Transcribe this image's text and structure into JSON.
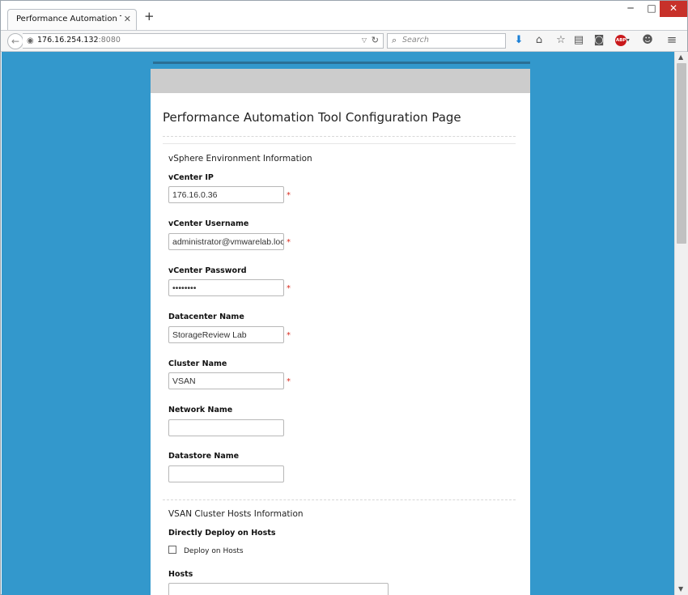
{
  "browser": {
    "tab_title": "Performance Automation Tool ...",
    "tab_close": "✕",
    "new_tab": "+",
    "window_controls": {
      "minimize": "─",
      "maximize": "□",
      "close": "✕"
    },
    "back_icon": "←",
    "url_host": "176.16.254.132",
    "url_port": ":8080",
    "url_globe_icon": "globe-icon",
    "dropdown_glyph": "▽",
    "reload_glyph": "↻",
    "search_placeholder": "Search",
    "search_glyph": "⌕",
    "icons": {
      "download": "⬇",
      "home": "⌂",
      "bookmark": "☆",
      "reader": "▤",
      "pocket": "◙",
      "abp_text": "ABP",
      "abp_caret": "▾",
      "smile": "☻",
      "menu": "≡"
    },
    "scroll_up": "▲",
    "scroll_down": "▼"
  },
  "page": {
    "title": "Performance Automation Tool Configuration Page",
    "sections": {
      "vsphere": "vSphere Environment Information",
      "vsan": "VSAN Cluster Hosts Information"
    },
    "required_mark": "*",
    "fields": {
      "vcenter_ip": {
        "label": "vCenter IP",
        "value": "176.16.0.36"
      },
      "vcenter_username": {
        "label": "vCenter Username",
        "value": "administrator@vmwarelab.loc"
      },
      "vcenter_password": {
        "label": "vCenter Password",
        "value": "••••••••"
      },
      "datacenter_name": {
        "label": "Datacenter Name",
        "value": "StorageReview Lab"
      },
      "cluster_name": {
        "label": "Cluster Name",
        "value": "VSAN"
      },
      "network_name": {
        "label": "Network Name",
        "value": ""
      },
      "datastore_name": {
        "label": "Datastore Name",
        "value": ""
      }
    },
    "deploy": {
      "label": "Directly Deploy on Hosts",
      "checkbox_label": "Deploy on Hosts",
      "checked": false
    },
    "hosts": {
      "label": "Hosts",
      "value": ""
    }
  },
  "colors": {
    "page_background": "#3398cc",
    "card_header": "#cccccc",
    "required": "#d9291c",
    "close_button": "#c7312a"
  }
}
